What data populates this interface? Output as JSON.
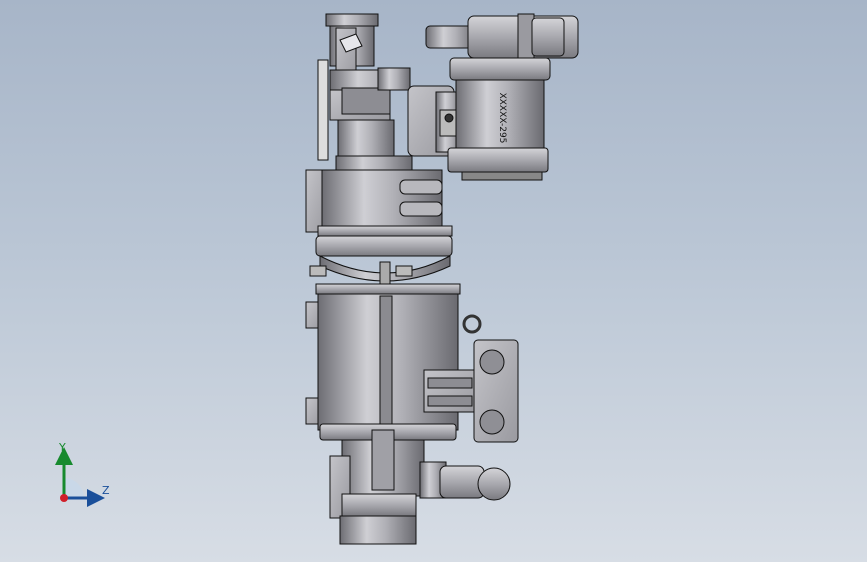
{
  "model": {
    "part_label": "XXXXX-295",
    "colors": {
      "background_top": "#a7b5c8",
      "background_bottom": "#d7dde5",
      "metal_light": "#c4c4c9",
      "metal_mid": "#9a9aa0",
      "metal_dark": "#6d6d73",
      "edge": "#111111"
    }
  },
  "triad": {
    "y_label": "Y",
    "z_label": "Z",
    "colors": {
      "y": "#178a2e",
      "z": "#1a4f9a",
      "x": "#d01f2a"
    }
  }
}
